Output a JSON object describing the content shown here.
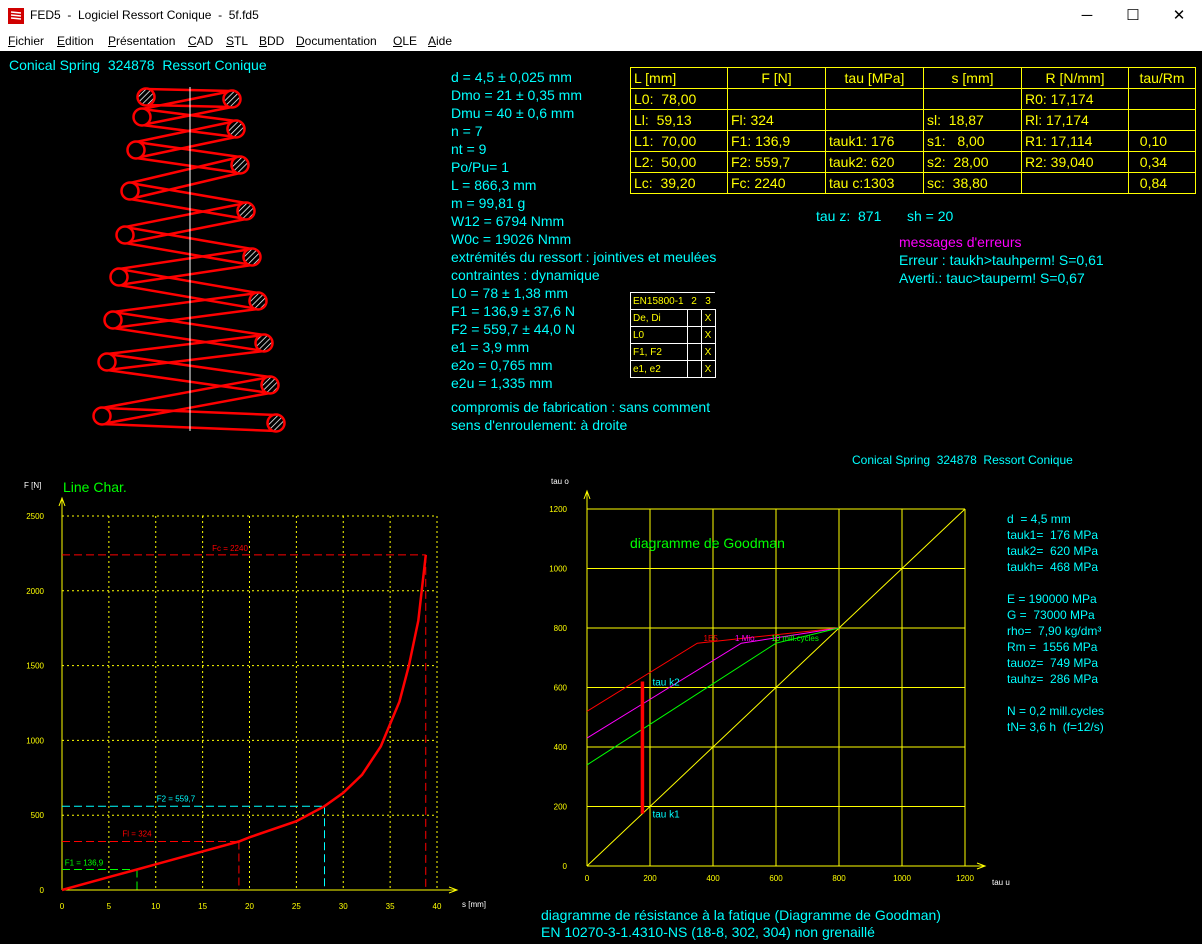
{
  "window": {
    "title": "FED5  -  Logiciel Ressort Conique  -  5f.fd5",
    "minimize_glyph": "─",
    "maximize_glyph": "☐",
    "close_glyph": "✕",
    "app_icon": "spring-app-icon"
  },
  "menu": [
    {
      "label": "Fichier",
      "u": "F",
      "rest": "ichier"
    },
    {
      "label": "Edition",
      "u": "E",
      "rest": "dition"
    },
    {
      "label": "Présentation",
      "u": "P",
      "rest": "résentation"
    },
    {
      "label": "CAD",
      "u": "C",
      "rest": "AD"
    },
    {
      "label": "STL",
      "u": "S",
      "rest": "TL"
    },
    {
      "label": "BDD",
      "u": "B",
      "rest": "DD"
    },
    {
      "label": "Documentation",
      "u": "D",
      "rest": "ocumentation"
    },
    {
      "label": "OLE",
      "u": "O",
      "rest": "LE"
    },
    {
      "label": "Aide",
      "u": "A",
      "rest": "ide"
    }
  ],
  "header_title": "Conical Spring  324878  Ressort Conique",
  "goodman_header": "Conical Spring  324878  Ressort Conique",
  "params": [
    "d = 4,5 ± 0,025 mm",
    "Dmo = 21 ± 0,35 mm",
    "Dmu = 40 ± 0,6 mm",
    "n = 7",
    "nt = 9",
    "Po/Pu= 1",
    "L = 866,3 mm",
    "m = 99,81 g",
    "W12 = 6794 Nmm",
    "W0c = 19026 Nmm",
    "extrémités du ressort : jointives et meulées",
    "contraintes : dynamique",
    "L0 = 78 ± 1,38 mm",
    "F1 = 136,9 ± 37,6 N",
    "F2 = 559,7 ± 44,0 N",
    "e1 = 3,9 mm",
    "e2o = 0,765 mm",
    "e2u = 1,335 mm",
    "compromis de fabrication : sans comment",
    "sens d'enroulement: à droite"
  ],
  "data_table": {
    "headers": [
      "L [mm]",
      "F [N]",
      "tau [MPa]",
      "s [mm]",
      "R [N/mm]",
      "tau/Rm"
    ],
    "rows": [
      [
        "L0:  78,00",
        "",
        "",
        "",
        "R0: 17,174",
        ""
      ],
      [
        "Ll:  59,13",
        "Fl: 324",
        "",
        "sl:  18,87",
        "Rl: 17,174",
        ""
      ],
      [
        "L1:  70,00",
        "F1: 136,9",
        "tauk1: 176",
        "s1:   8,00",
        "R1: 17,114",
        "  0,10"
      ],
      [
        "L2:  50,00",
        "F2: 559,7",
        "tauk2: 620",
        "s2:  28,00",
        "R2: 39,040",
        "  0,34"
      ],
      [
        "Lc:  39,20",
        "Fc: 2240",
        "tau c:1303",
        "sc:  38,80",
        "",
        "  0,84"
      ]
    ],
    "tauz": "tau z:  871",
    "sh": "sh = 20"
  },
  "errors": {
    "title": "messages d'erreurs",
    "lines": [
      "Erreur : taukh>tauhperm! S=0,61",
      "Averti.: tauc>tauperm! S=0,67"
    ]
  },
  "en_table": {
    "header": [
      "EN15800-1",
      "2",
      "3"
    ],
    "rows": [
      [
        "De, Di",
        "",
        "X"
      ],
      [
        "L0",
        "",
        "X"
      ],
      [
        "F1, F2",
        "",
        "X"
      ],
      [
        "e1, e2",
        "",
        "X"
      ]
    ]
  },
  "line_chart": {
    "title": "Line Char.",
    "ylabel": "F [N]",
    "xlabel": "s [mm]",
    "xticks": [
      0,
      5,
      10,
      15,
      20,
      25,
      30,
      35,
      40
    ],
    "yticks": [
      0,
      500,
      1000,
      1500,
      2000,
      2500
    ],
    "labels": {
      "Fc": "Fc = 2240",
      "F2": "F2 = 559,7",
      "Fl": "Fl = 324",
      "F1": "F1 = 136,9"
    }
  },
  "goodman": {
    "title": "diagramme de Goodman",
    "ylabel": "tau o",
    "xlabel": "tau u",
    "ticks": [
      0,
      200,
      400,
      600,
      800,
      1000,
      1200
    ],
    "curve_labels": {
      "a": "1E5",
      "b": "1 Mio.",
      "c": "10 mill.cycles"
    },
    "tauk2": "tau k2",
    "tauk1": "tau k1",
    "props": [
      "d  = 4,5 mm",
      "tauk1=  176 MPa",
      "tauk2=  620 MPa",
      "taukh=  468 MPa",
      "",
      "E = 190000 MPa",
      "G =  73000 MPa",
      "rho=  7,90 kg/dm³",
      "Rm =  1556 MPa",
      "tauoz=  749 MPa",
      "tauhz=  286 MPa",
      "",
      "N = 0,2 mill.cycles",
      "tN= 3,6 h  (f=12/s)"
    ],
    "footer1": "diagramme de résistance à la fatique (Diagramme de Goodman)",
    "footer2": "EN 10270-3-1.4310-NS (18-8, 302, 304) non grenaillé"
  },
  "chart_data": [
    {
      "type": "line",
      "title": "Line Char.",
      "xlabel": "s [mm]",
      "ylabel": "F [N]",
      "xlim": [
        0,
        40
      ],
      "ylim": [
        0,
        2500
      ],
      "grid": true,
      "series": [
        {
          "values": [
            [
              0,
              0
            ],
            [
              5,
              86
            ],
            [
              8,
              137
            ],
            [
              10,
              172
            ],
            [
              15,
              258
            ],
            [
              18.87,
              324
            ],
            [
              20,
              352
            ],
            [
              25,
              460
            ],
            [
              28,
              560
            ],
            [
              30,
              650
            ],
            [
              32,
              770
            ],
            [
              34,
              960
            ],
            [
              36,
              1260
            ],
            [
              37,
              1500
            ],
            [
              38,
              1800
            ],
            [
              38.8,
              2240
            ]
          ]
        }
      ],
      "markers": {
        "s1": 8.0,
        "F1": 136.9,
        "sl": 18.87,
        "Fl": 324,
        "s2": 28.0,
        "F2": 559.7,
        "sc": 38.8,
        "Fc": 2240
      }
    },
    {
      "type": "line",
      "title": "diagramme de Goodman",
      "xlabel": "tau u",
      "ylabel": "tau o",
      "xlim": [
        0,
        1200
      ],
      "ylim": [
        0,
        1200
      ],
      "grid": true,
      "series": [
        {
          "name": "1E5",
          "values": [
            [
              0,
              520
            ],
            [
              350,
              749
            ],
            [
              800,
              800
            ]
          ]
        },
        {
          "name": "1 Mio.",
          "values": [
            [
              0,
              430
            ],
            [
              490,
              749
            ],
            [
              800,
              800
            ]
          ]
        },
        {
          "name": "10 mill.cycles",
          "values": [
            [
              0,
              340
            ],
            [
              600,
              749
            ],
            [
              800,
              800
            ]
          ]
        }
      ],
      "diagonal": [
        [
          0,
          0
        ],
        [
          1200,
          1200
        ]
      ],
      "load_line": {
        "tauk1": 176,
        "tauk2": 620
      }
    }
  ]
}
